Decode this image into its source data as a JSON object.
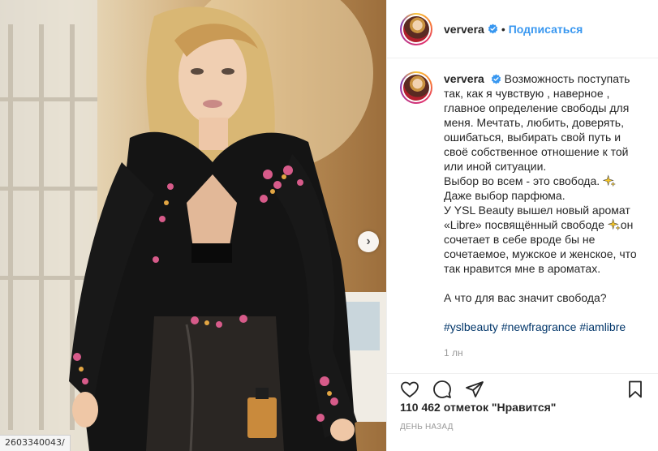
{
  "post": {
    "username": "ververa",
    "follow_label": "Подписаться",
    "separator": "•",
    "caption_lines": [
      "Возможность поступать",
      "так, как я чувствую , наверное ,",
      "главное определение свободы для",
      "меня. Мечтать, любить, доверять,",
      "ошибаться, выбирать свой путь и",
      "своё собственное отношение к той",
      "или иной ситуации.",
      "Выбор во всем - это свобода.",
      "Даже выбор парфюма.",
      "У YSL Beauty вышел новый аромат",
      "«Libre» посвящённый свободе",
      "сочетает в себе вроде бы не",
      "сочетаемое, мужское и женское, что",
      "так нравится мне в ароматах.",
      "А что для вас значит свобода?"
    ],
    "caption_line_on": "он",
    "hashtags": [
      "#yslbeauty",
      "#newfragrance",
      "#iamlibre"
    ],
    "time_ago": "1 лн",
    "likes_count": "110 462",
    "likes_text": "отметок \"Нравится\"",
    "date_label": "день назад",
    "emoji_icon": "sparkle-icon"
  },
  "browser": {
    "status_url": "2603340043/"
  },
  "colors": {
    "link": "#3897f0",
    "hashtag": "#003569",
    "text": "#262626",
    "muted": "#999999"
  }
}
